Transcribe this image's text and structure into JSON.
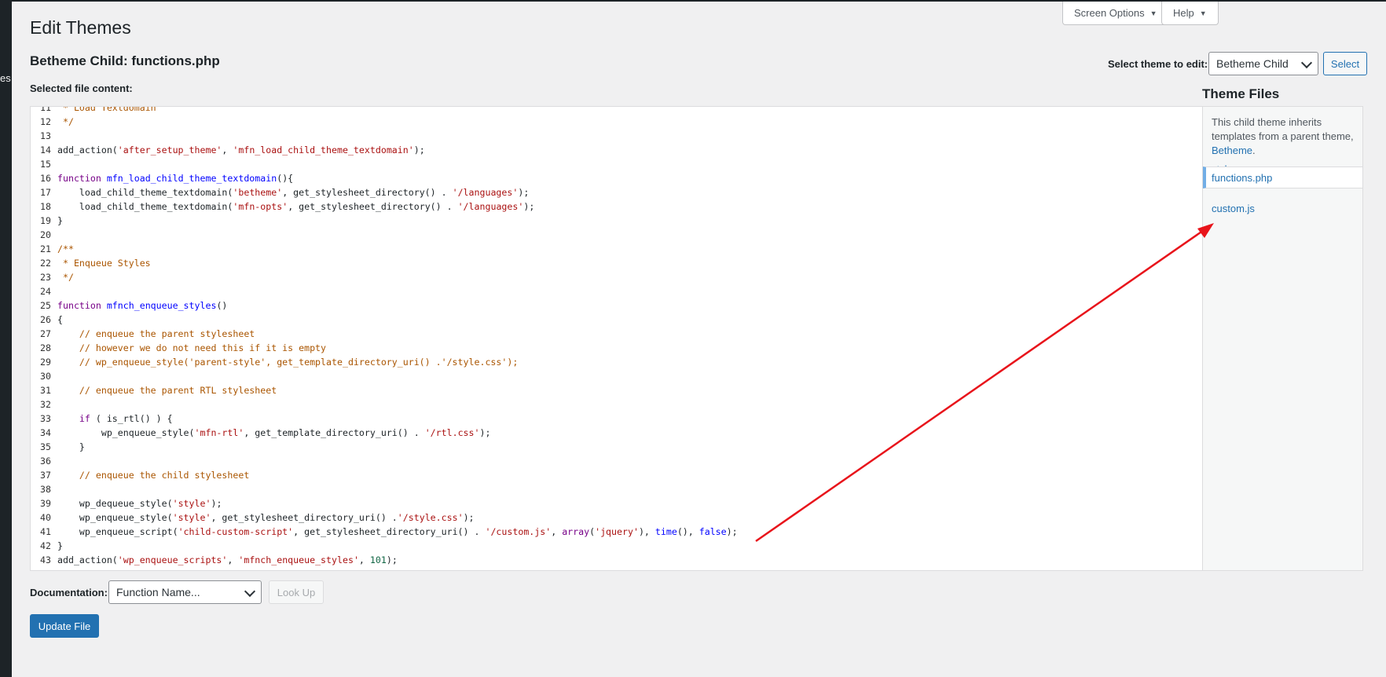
{
  "sidebar": {
    "fragment": "es"
  },
  "header": {
    "screen_options": "Screen Options",
    "help": "Help",
    "title": "Edit Themes",
    "file_title": "Betheme Child: functions.php",
    "selected_label": "Selected file content:"
  },
  "theme_select": {
    "label": "Select theme to edit:",
    "value": "Betheme Child",
    "button": "Select"
  },
  "editor": {
    "lines": [
      {
        "n": "11",
        "parts": [
          {
            "t": " * Load Textdomain",
            "c": "cm"
          }
        ]
      },
      {
        "n": "12",
        "parts": [
          {
            "t": " */",
            "c": "cm"
          }
        ]
      },
      {
        "n": "13",
        "parts": []
      },
      {
        "n": "14",
        "parts": [
          {
            "t": "add_action(",
            "c": ""
          },
          {
            "t": "'after_setup_theme'",
            "c": "str"
          },
          {
            "t": ", ",
            "c": ""
          },
          {
            "t": "'mfn_load_child_theme_textdomain'",
            "c": "str"
          },
          {
            "t": ");",
            "c": ""
          }
        ]
      },
      {
        "n": "15",
        "parts": []
      },
      {
        "n": "16",
        "parts": [
          {
            "t": "function",
            "c": "kw"
          },
          {
            "t": " ",
            "c": ""
          },
          {
            "t": "mfn_load_child_theme_textdomain",
            "c": "def"
          },
          {
            "t": "(){",
            "c": ""
          }
        ]
      },
      {
        "n": "17",
        "parts": [
          {
            "t": "    load_child_theme_textdomain(",
            "c": ""
          },
          {
            "t": "'betheme'",
            "c": "str"
          },
          {
            "t": ", get_stylesheet_directory() . ",
            "c": ""
          },
          {
            "t": "'/languages'",
            "c": "str"
          },
          {
            "t": ");",
            "c": ""
          }
        ]
      },
      {
        "n": "18",
        "parts": [
          {
            "t": "    load_child_theme_textdomain(",
            "c": ""
          },
          {
            "t": "'mfn-opts'",
            "c": "str"
          },
          {
            "t": ", get_stylesheet_directory() . ",
            "c": ""
          },
          {
            "t": "'/languages'",
            "c": "str"
          },
          {
            "t": ");",
            "c": ""
          }
        ]
      },
      {
        "n": "19",
        "parts": [
          {
            "t": "}",
            "c": ""
          }
        ]
      },
      {
        "n": "20",
        "parts": []
      },
      {
        "n": "21",
        "parts": [
          {
            "t": "/**",
            "c": "cm"
          }
        ]
      },
      {
        "n": "22",
        "parts": [
          {
            "t": " * Enqueue Styles",
            "c": "cm"
          }
        ]
      },
      {
        "n": "23",
        "parts": [
          {
            "t": " */",
            "c": "cm"
          }
        ]
      },
      {
        "n": "24",
        "parts": []
      },
      {
        "n": "25",
        "parts": [
          {
            "t": "function",
            "c": "kw"
          },
          {
            "t": " ",
            "c": ""
          },
          {
            "t": "mfnch_enqueue_styles",
            "c": "def"
          },
          {
            "t": "()",
            "c": ""
          }
        ]
      },
      {
        "n": "26",
        "parts": [
          {
            "t": "{",
            "c": ""
          }
        ]
      },
      {
        "n": "27",
        "parts": [
          {
            "t": "    // enqueue the parent stylesheet",
            "c": "cm"
          }
        ]
      },
      {
        "n": "28",
        "parts": [
          {
            "t": "    // however we do not need this if it is empty",
            "c": "cm"
          }
        ]
      },
      {
        "n": "29",
        "parts": [
          {
            "t": "    // wp_enqueue_style('parent-style', get_template_directory_uri() .'/style.css');",
            "c": "cm"
          }
        ]
      },
      {
        "n": "30",
        "parts": []
      },
      {
        "n": "31",
        "parts": [
          {
            "t": "    // enqueue the parent RTL stylesheet",
            "c": "cm"
          }
        ]
      },
      {
        "n": "32",
        "parts": []
      },
      {
        "n": "33",
        "parts": [
          {
            "t": "    ",
            "c": ""
          },
          {
            "t": "if",
            "c": "kw"
          },
          {
            "t": " ( is_rtl() ) {",
            "c": ""
          }
        ]
      },
      {
        "n": "34",
        "parts": [
          {
            "t": "        wp_enqueue_style(",
            "c": ""
          },
          {
            "t": "'mfn-rtl'",
            "c": "str"
          },
          {
            "t": ", get_template_directory_uri() . ",
            "c": ""
          },
          {
            "t": "'/rtl.css'",
            "c": "str"
          },
          {
            "t": ");",
            "c": ""
          }
        ]
      },
      {
        "n": "35",
        "parts": [
          {
            "t": "    }",
            "c": ""
          }
        ]
      },
      {
        "n": "36",
        "parts": []
      },
      {
        "n": "37",
        "parts": [
          {
            "t": "    // enqueue the child stylesheet",
            "c": "cm"
          }
        ]
      },
      {
        "n": "38",
        "parts": []
      },
      {
        "n": "39",
        "parts": [
          {
            "t": "    wp_dequeue_style(",
            "c": ""
          },
          {
            "t": "'style'",
            "c": "str"
          },
          {
            "t": ");",
            "c": ""
          }
        ]
      },
      {
        "n": "40",
        "parts": [
          {
            "t": "    wp_enqueue_style(",
            "c": ""
          },
          {
            "t": "'style'",
            "c": "str"
          },
          {
            "t": ", get_stylesheet_directory_uri() .",
            "c": ""
          },
          {
            "t": "'/style.css'",
            "c": "str"
          },
          {
            "t": ");",
            "c": ""
          }
        ]
      },
      {
        "n": "41",
        "parts": [
          {
            "t": "    wp_enqueue_script(",
            "c": ""
          },
          {
            "t": "'child-custom-script'",
            "c": "str"
          },
          {
            "t": ", get_stylesheet_directory_uri() . ",
            "c": ""
          },
          {
            "t": "'/custom.js'",
            "c": "str"
          },
          {
            "t": ", ",
            "c": ""
          },
          {
            "t": "array",
            "c": "kw"
          },
          {
            "t": "(",
            "c": ""
          },
          {
            "t": "'jquery'",
            "c": "str"
          },
          {
            "t": "), ",
            "c": ""
          },
          {
            "t": "time",
            "c": "def"
          },
          {
            "t": "(), ",
            "c": ""
          },
          {
            "t": "false",
            "c": "def"
          },
          {
            "t": ");",
            "c": ""
          }
        ]
      },
      {
        "n": "42",
        "parts": [
          {
            "t": "}",
            "c": ""
          }
        ]
      },
      {
        "n": "43",
        "parts": [
          {
            "t": "add_action(",
            "c": ""
          },
          {
            "t": "'wp_enqueue_scripts'",
            "c": "str"
          },
          {
            "t": ", ",
            "c": ""
          },
          {
            "t": "'mfnch_enqueue_styles'",
            "c": "str"
          },
          {
            "t": ", ",
            "c": ""
          },
          {
            "t": "101",
            "c": "num"
          },
          {
            "t": ");",
            "c": ""
          }
        ]
      }
    ]
  },
  "theme_files": {
    "title": "Theme Files",
    "note_text": "This child theme inherits templates from a parent theme,",
    "parent_link": "Betheme",
    "note_period": ".",
    "files": [
      "style.css",
      "functions.php",
      "custom.js"
    ],
    "active_index": 1
  },
  "documentation": {
    "label": "Documentation:",
    "select_value": "Function Name...",
    "lookup": "Look Up"
  },
  "update_button": "Update File",
  "colors": {
    "accent": "#2271b1",
    "annotation_arrow": "#e8141b"
  }
}
